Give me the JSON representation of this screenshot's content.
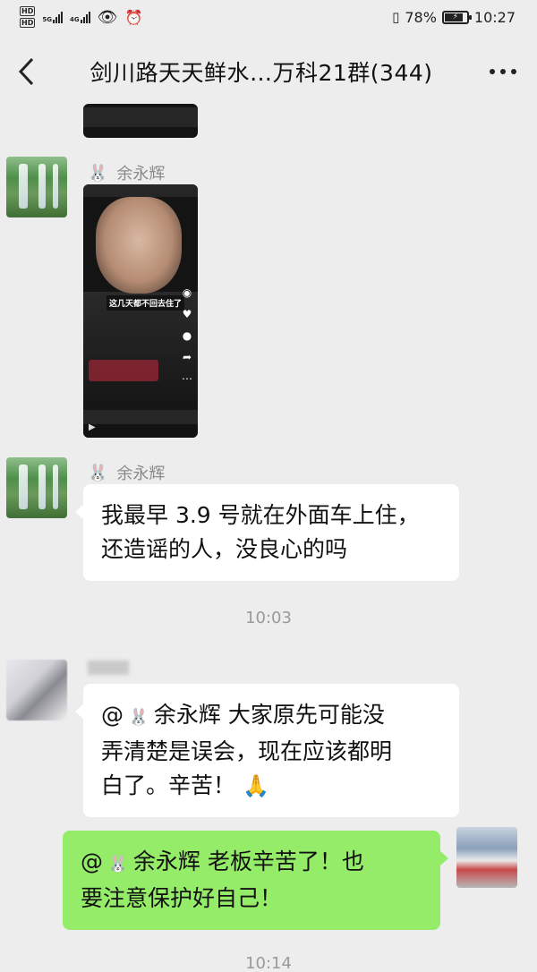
{
  "status_bar": {
    "hd1": "HD",
    "hd2": "HD",
    "net1": "5G",
    "net2": "4G",
    "battery": "78%",
    "time": "10:27"
  },
  "header": {
    "back_icon": "chevron-left-icon",
    "title": "剑川路天天鲜水…万科21群(344)",
    "more_icon": "more-dots-icon"
  },
  "messages": {
    "m1": {
      "sender": "余永辉",
      "type": "video",
      "caption": "这几天都不回去住了"
    },
    "m2": {
      "sender": "余永辉",
      "text_line1": "我最早 3.9 号就在外面车上住，",
      "text_line2": "还造谣的人，没良心的吗"
    },
    "time1": "10:03",
    "m3": {
      "sender": "",
      "at": "@",
      "mention": "余永辉",
      "text_line1": "大家原先可能没",
      "text_line2": "弄清楚是误会，现在应该都明",
      "text_line3": "白了。辛苦！",
      "emoji": "🙏"
    },
    "m4": {
      "at": "@",
      "mention": "余永辉",
      "text_line1": "老板辛苦了！也",
      "text_line2": "要注意保护好自己！"
    },
    "time2": "10:14"
  },
  "colors": {
    "background": "#ededed",
    "bubble_self": "#95ec69",
    "bubble_other": "#ffffff"
  }
}
